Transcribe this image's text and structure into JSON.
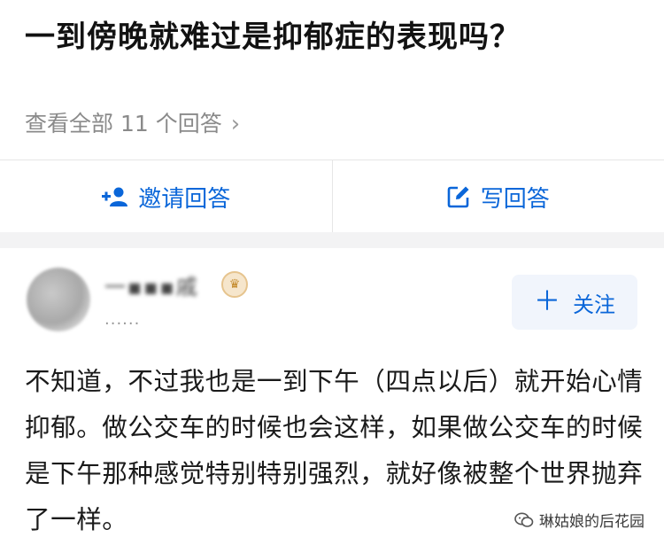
{
  "question": {
    "title": "一到傍晚就难过是抑郁症的表现吗？",
    "view_all": "查看全部 11 个回答",
    "view_all_chevron": "›"
  },
  "actions": {
    "invite_label": "邀请回答",
    "write_label": "写回答"
  },
  "author": {
    "name": "一▪▪▪戚",
    "bio": "......",
    "badge_icon": "crown-badge-icon"
  },
  "follow": {
    "plus": "＋",
    "label": "关注"
  },
  "answer": {
    "text": "不知道，不过我也是一到下午（四点以后）就开始心情抑郁。做公交车的时候也会这样，如果做公交车的时候是下午那种感觉特别特别强烈，就好像被整个世界抛弃了一样。"
  },
  "watermark": {
    "text": "琳姑娘的后花园"
  },
  "colors": {
    "accent": "#0a66d9",
    "muted": "#8a8a8a",
    "divider": "#e6e6e6"
  }
}
